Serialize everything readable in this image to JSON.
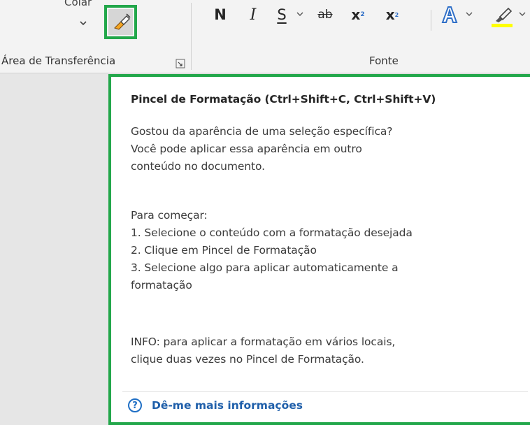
{
  "ribbon": {
    "clipboard": {
      "paste_label": "Colar",
      "group_label": "Área de Transferência",
      "format_painter_icon": "paintbrush-icon"
    },
    "font": {
      "group_label": "Fonte",
      "bold": "N",
      "italic": "I",
      "underline": "S",
      "strikethrough": "ab",
      "subscript_base": "x",
      "subscript_mark": "2",
      "superscript_base": "x",
      "superscript_mark": "2",
      "highlight_color": "#ffff00",
      "accent_color": "#2f6fc7"
    }
  },
  "tooltip": {
    "title": "Pincel de Formatação (Ctrl+Shift+C, Ctrl+Shift+V)",
    "paragraph1": "Gostou da aparência de uma seleção específica?\nVocê pode aplicar essa aparência em outro\nconteúdo no documento.",
    "paragraph2": "Para começar:\n1. Selecione o conteúdo com a formatação desejada\n2. Clique em Pincel de Formatação\n3. Selecione algo para aplicar automaticamente a\nformatação",
    "paragraph3": "INFO: para aplicar a formatação em vários locais,\nclique duas vezes no Pincel de Formatação.",
    "help_glyph": "?",
    "link_text": "Dê-me mais informações"
  },
  "highlight_border_color": "#22a74a"
}
